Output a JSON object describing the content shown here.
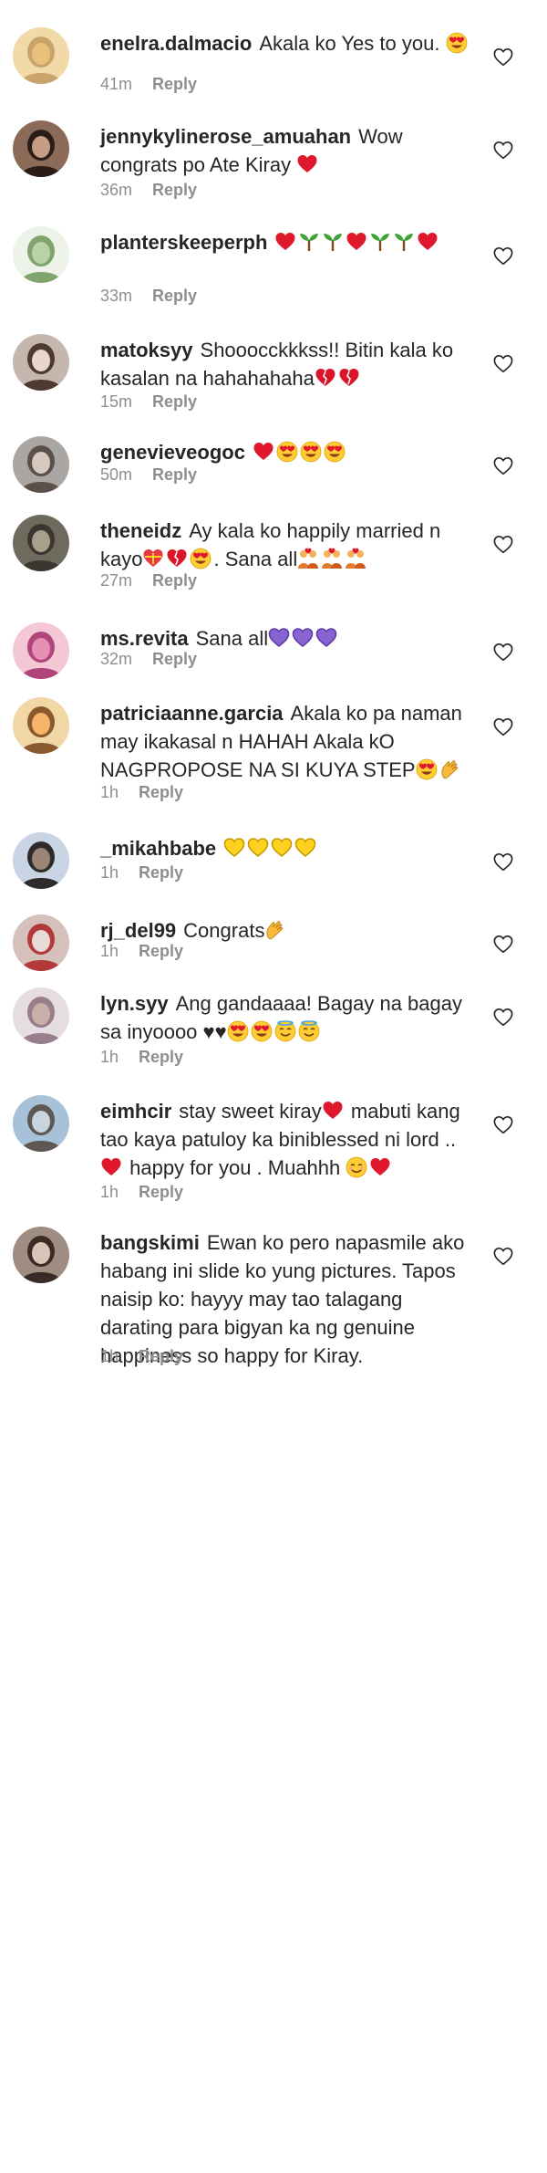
{
  "comments": [
    {
      "username": "enelra.dalmacio",
      "text": "Akala ko Yes to you. ",
      "emojis": [
        "heart-eyes-face"
      ],
      "time": "41m",
      "reply": "Reply"
    },
    {
      "username": "jennykylinerose_amuahan",
      "text": "Wow congrats po Ate Kiray ",
      "emojis": [
        "red-heart"
      ],
      "time": "36m",
      "reply": "Reply"
    },
    {
      "username": "planterskeeperph",
      "text": "",
      "emojis": [
        "red-heart",
        "seedling",
        "seedling",
        "red-heart",
        "seedling",
        "seedling",
        "red-heart"
      ],
      "time": "33m",
      "reply": "Reply"
    },
    {
      "username": "matoksyy",
      "text": "Shooocckkkss!! Bitin kala ko kasalan na hahahahaha",
      "emojis": [
        "broken-heart",
        "broken-heart"
      ],
      "time": "15m",
      "reply": "Reply"
    },
    {
      "username": "genevieveogoc",
      "text": "",
      "emojis": [
        "red-heart",
        "heart-eyes-face",
        "heart-eyes-face",
        "heart-eyes-face"
      ],
      "time": "50m",
      "reply": "Reply"
    },
    {
      "username": "theneidz",
      "text": "Ay kala ko happily married n kayo",
      "emojis": [
        "heart-with-ribbon",
        "broken-heart",
        "heart-eyes-face"
      ],
      "text_after": ". Sana all",
      "emojis_after": [
        "couple",
        "couple",
        "couple"
      ],
      "time": "27m",
      "reply": "Reply"
    },
    {
      "username": "ms.revita",
      "text": "Sana all",
      "emojis": [
        "purple-heart",
        "purple-heart",
        "purple-heart"
      ],
      "time": "32m",
      "reply": "Reply"
    },
    {
      "username": "patriciaanne.garcia",
      "text": "Akala ko pa naman may ikakasal n HAHAH Akala kO NAGPROPOSE NA SI KUYA STEP",
      "emojis": [
        "heart-eyes-face",
        "clapping-hands"
      ],
      "time": "1h",
      "reply": "Reply"
    },
    {
      "username": "_mikahbabe",
      "text": "",
      "emojis": [
        "yellow-heart",
        "yellow-heart",
        "yellow-heart",
        "yellow-heart"
      ],
      "time": "1h",
      "reply": "Reply"
    },
    {
      "username": "rj_del99",
      "text": "Congrats",
      "emojis": [
        "clapping-hands"
      ],
      "time": "1h",
      "reply": "Reply"
    },
    {
      "username": "lyn.syy",
      "text": "Ang gandaaaa! Bagay na bagay sa inyoooo ♥♥",
      "emojis": [
        "heart-eyes-face",
        "heart-eyes-face",
        "smiling-face-with-halo",
        "smiling-face-with-halo"
      ],
      "time": "1h",
      "reply": "Reply"
    },
    {
      "username": "eimhcir",
      "text": "stay sweet kiray",
      "emojis": [
        "red-heart"
      ],
      "text_after": " mabuti kang tao kaya patuloy ka biniblessed ni lord .. ",
      "emojis_after": [
        "red-heart"
      ],
      "text_after2": " happy for you . Muahhh ",
      "emojis_after2": [
        "smiling-face",
        "red-heart"
      ],
      "time": "1h",
      "reply": "Reply"
    },
    {
      "username": "bangskimi",
      "text": "Ewan ko pero napasmile ako habang ini slide ko yung pictures. Tapos naisip ko: hayyy may tao talagang darating para bigyan ka ng genuine happiness so happy for Kiray.",
      "emojis": [],
      "time": "1h",
      "reply": "Reply"
    }
  ],
  "colors": {
    "username": "#262626",
    "meta": "#8e8e8e",
    "heart": "#262626"
  }
}
